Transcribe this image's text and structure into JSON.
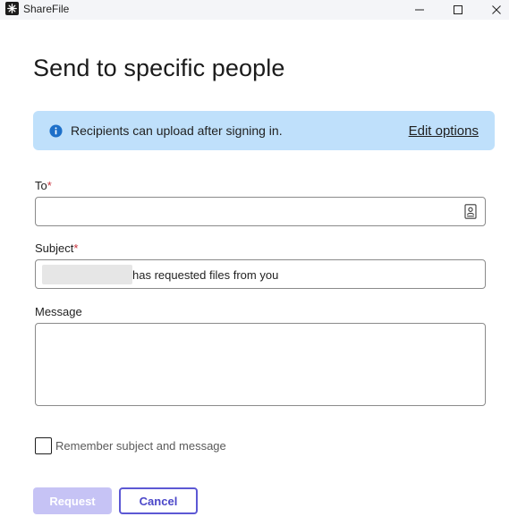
{
  "window": {
    "app_title": "ShareFile",
    "controls": {
      "minimize": "minimize",
      "maximize": "maximize",
      "close": "close"
    }
  },
  "page": {
    "title": "Send to specific people"
  },
  "banner": {
    "icon": "info-icon",
    "text": "Recipients can upload after signing in.",
    "link_label": "Edit options",
    "color": "#bfe0fb"
  },
  "form": {
    "to": {
      "label": "To",
      "required_mark": "*",
      "value": "",
      "icon": "contact-book-icon"
    },
    "subject": {
      "label": "Subject",
      "required_mark": "*",
      "value_suffix": "has requested files from you",
      "redacted_prefix": true
    },
    "message": {
      "label": "Message",
      "value": ""
    },
    "remember": {
      "label": "Remember subject and message",
      "checked": false
    }
  },
  "actions": {
    "request_label": "Request",
    "cancel_label": "Cancel",
    "request_enabled": false,
    "accent": "#5c58d4"
  }
}
